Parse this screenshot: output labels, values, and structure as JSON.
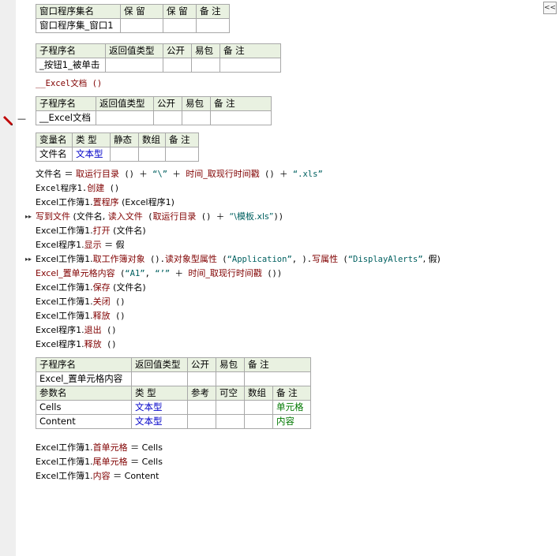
{
  "toolbar": {
    "collapse_label": "<<"
  },
  "tables": {
    "assembly": {
      "headers": [
        "窗口程序集名",
        "保 留",
        "保 留",
        "备 注"
      ],
      "row": [
        "窗口程序集_窗口1",
        "",
        "",
        ""
      ]
    },
    "sub1": {
      "headers": [
        "子程序名",
        "返回值类型",
        "公开",
        "易包",
        "备 注"
      ],
      "row": [
        "_按钮1_被单击",
        "",
        "",
        "",
        ""
      ]
    },
    "sub2": {
      "headers": [
        "子程序名",
        "返回值类型",
        "公开",
        "易包",
        "备 注"
      ],
      "row": [
        "__Excel文档",
        "",
        "",
        "",
        ""
      ]
    },
    "vars": {
      "headers": [
        "变量名",
        "类 型",
        "静态",
        "数组",
        "备 注"
      ],
      "row": [
        "文件名",
        "文本型",
        "",
        "",
        ""
      ]
    },
    "sub3": {
      "headers": [
        "子程序名",
        "返回值类型",
        "公开",
        "易包",
        "备 注"
      ],
      "row": [
        "Excel_置单元格内容",
        "",
        "",
        "",
        ""
      ],
      "param_headers": [
        "参数名",
        "类 型",
        "参考",
        "可空",
        "数组",
        "备 注"
      ],
      "params": [
        [
          "Cells",
          "文本型",
          "",
          "",
          "",
          "单元格"
        ],
        [
          "Content",
          "文本型",
          "",
          "",
          "",
          "内容"
        ]
      ]
    }
  },
  "code": {
    "call_excel_doc": "__Excel文档 ()",
    "l1": "文件名 ＝ ",
    "l1_f1": "取运行目录",
    "l1_b": " () ＋ ",
    "l1_s1": "“\\”",
    "l1_c": " ＋ ",
    "l1_f2": "时间_取现行时间戳",
    "l1_d": " () ＋ ",
    "l1_s2": "“.xls”",
    "l2_a": "Excel程序1.",
    "l2_m": "创建",
    "l2_b": " ()",
    "l3_a": "Excel工作簿1.",
    "l3_m": "置程序",
    "l3_b": " (Excel程序1)",
    "l4_f": "写到文件",
    "l4_b": " (文件名, ",
    "l4_f2": "读入文件",
    "l4_c": " (",
    "l4_f3": "取运行目录",
    "l4_d": " () ＋ ",
    "l4_s": "“\\模板.xls”",
    "l4_e": "))",
    "l5_a": "Excel工作簿1.",
    "l5_m": "打开",
    "l5_b": " (文件名)",
    "l6_a": "Excel程序1.",
    "l6_m": "显示",
    "l6_b": " ＝ 假",
    "l7_a": "Excel工作簿1.",
    "l7_m": "取工作簿对象",
    "l7_b": " ().",
    "l7_m2": "读对象型属性",
    "l7_c": " (",
    "l7_s1": "“Application”",
    "l7_d": ", ).",
    "l7_m3": "写属性",
    "l7_e": " (",
    "l7_s2": "“DisplayAlerts”",
    "l7_f": ", 假)",
    "l8_f": "Excel_置单元格内容",
    "l8_b": " (",
    "l8_s1": "“A1”",
    "l8_c": ", ",
    "l8_s2": "“’”",
    "l8_d": " ＋ ",
    "l8_f2": "时间_取现行时间戳",
    "l8_e": " ())",
    "l9_a": "Excel工作簿1.",
    "l9_m": "保存",
    "l9_b": " (文件名)",
    "l10_a": "Excel工作簿1.",
    "l10_m": "关闭",
    "l10_b": " ()",
    "l11_a": "Excel工作簿1.",
    "l11_m": "释放",
    "l11_b": " ()",
    "l12_a": "Excel程序1.",
    "l12_m": "退出",
    "l12_b": " ()",
    "l13_a": "Excel程序1.",
    "l13_m": "释放",
    "l13_b": " ()",
    "m1": "Excel工作簿1.",
    "m1_m": "首单元格",
    "m1_b": " ＝ Cells",
    "m2": "Excel工作簿1.",
    "m2_m": "尾单元格",
    "m2_b": " ＝ Cells",
    "m3": "Excel工作簿1.",
    "m3_m": "内容",
    "m3_b": " ＝ Content"
  },
  "colors": {
    "gutter": "#efefef",
    "header_bg": "#e9f1e1",
    "keyword": "#800000",
    "type_blue": "#0000c8",
    "comment_green": "#007800",
    "string": "#006060"
  },
  "icons": {
    "collapse": "double-chevron-left-icon",
    "breakpoint": "pencil-icon",
    "expand_arrow": "double-chevron-right-icon"
  }
}
